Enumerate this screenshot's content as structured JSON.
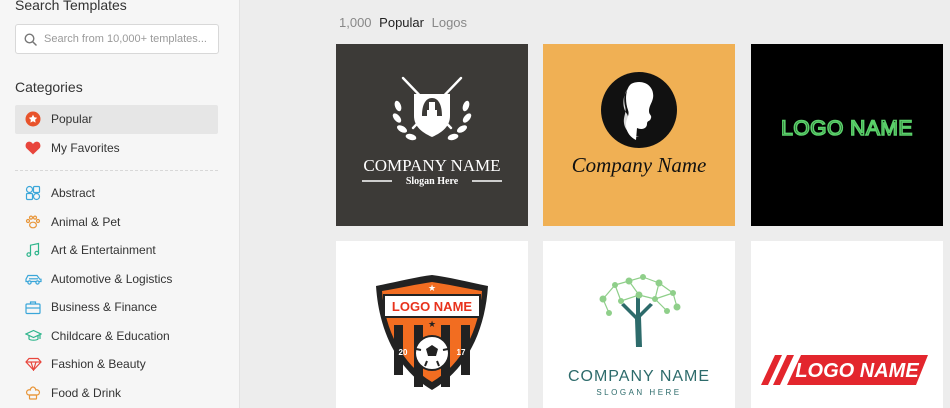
{
  "sidebar": {
    "search_title": "Search Templates",
    "search_placeholder": "Search from 10,000+ templates...",
    "categories_title": "Categories",
    "pinned": [
      {
        "label": "Popular",
        "icon": "star-badge-icon",
        "color": "#e8532b"
      },
      {
        "label": "My Favorites",
        "icon": "heart-icon",
        "color": "#e8453c"
      }
    ],
    "items": [
      {
        "label": "Abstract",
        "icon": "abstract-icon",
        "color": "#3aa6d9"
      },
      {
        "label": "Animal & Pet",
        "icon": "paw-icon",
        "color": "#e8963a"
      },
      {
        "label": "Art & Entertainment",
        "icon": "music-note-icon",
        "color": "#2fb58c"
      },
      {
        "label": "Automotive & Logistics",
        "icon": "car-icon",
        "color": "#3aa6d9"
      },
      {
        "label": "Business & Finance",
        "icon": "briefcase-icon",
        "color": "#3aa6d9"
      },
      {
        "label": "Childcare & Education",
        "icon": "graduation-cap-icon",
        "color": "#2fb58c"
      },
      {
        "label": "Fashion & Beauty",
        "icon": "diamond-icon",
        "color": "#e8453c"
      },
      {
        "label": "Food & Drink",
        "icon": "chef-hat-icon",
        "color": "#e8963a"
      }
    ]
  },
  "breadcrumb": {
    "count": "1,000",
    "current": "Popular",
    "section": "Logos"
  },
  "templates": [
    {
      "name": "spartan-crest-logo",
      "line1": "COMPANY NAME",
      "line2": "Slogan Here",
      "bg": "#3c3a37"
    },
    {
      "name": "woman-silhouette-logo",
      "line1": "Company Name",
      "bg": "#f0b054"
    },
    {
      "name": "neon-logo",
      "line1": "LOGO NAME",
      "bg": "#000000",
      "accent": "#5ad16a"
    },
    {
      "name": "soccer-shield-logo",
      "line1": "LOGO NAME",
      "num_left": "20",
      "num_right": "17",
      "bg": "#ffffff"
    },
    {
      "name": "tree-network-logo",
      "line1": "COMPANY NAME",
      "line2": "SLOGAN HERE",
      "bg": "#ffffff",
      "accent": "#2d6b6b"
    },
    {
      "name": "red-stripe-logo",
      "line1": "LOGO NAME",
      "bg": "#ffffff",
      "accent": "#e3262d"
    }
  ]
}
